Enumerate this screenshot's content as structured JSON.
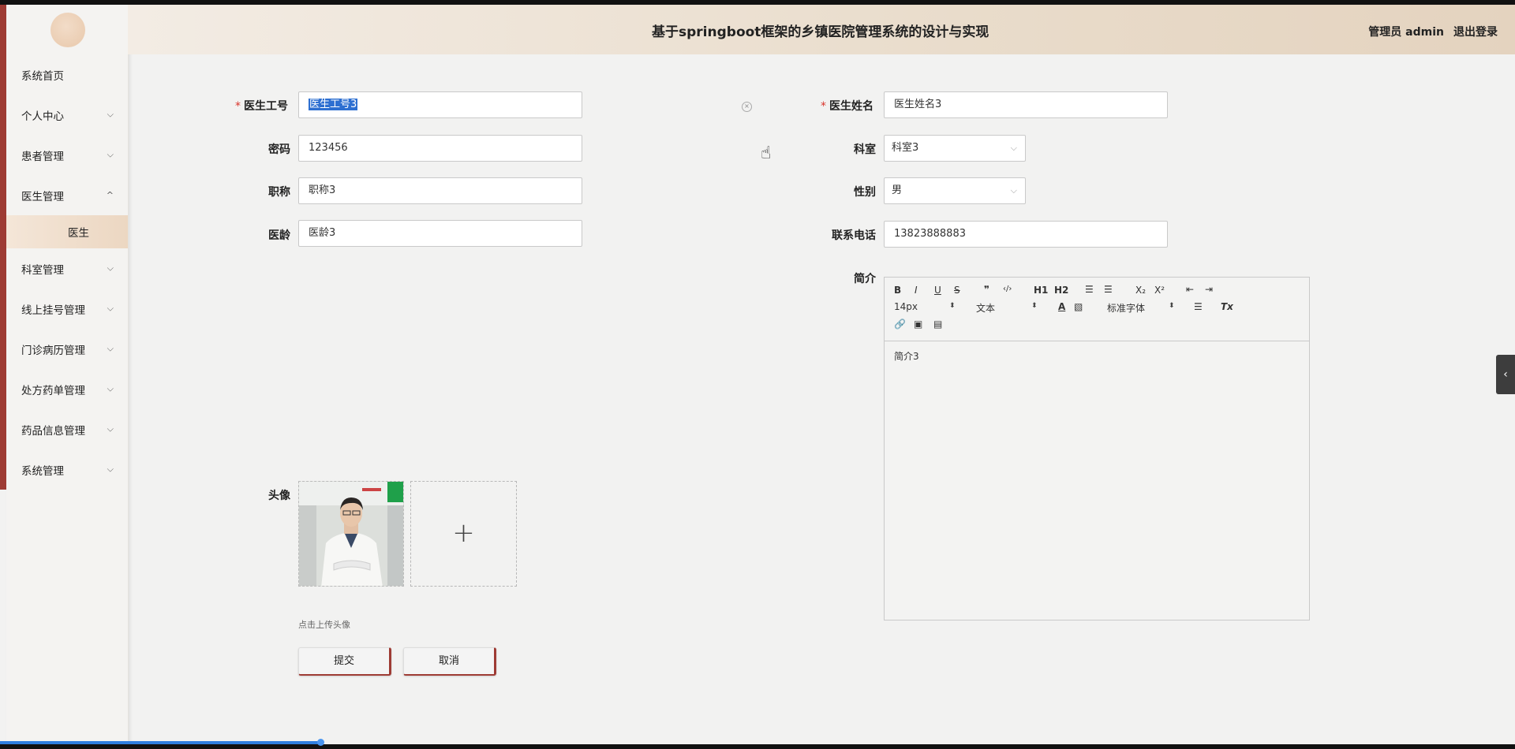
{
  "header": {
    "title": "基于springboot框架的乡镇医院管理系统的设计与实现",
    "user_label": "管理员 admin",
    "logout_label": "退出登录"
  },
  "sidebar": {
    "items": [
      {
        "label": "系统首页"
      },
      {
        "label": "个人中心"
      },
      {
        "label": "患者管理"
      },
      {
        "label": "医生管理"
      },
      {
        "label": "医生"
      },
      {
        "label": "科室管理"
      },
      {
        "label": "线上挂号管理"
      },
      {
        "label": "门诊病历管理"
      },
      {
        "label": "处方药单管理"
      },
      {
        "label": "药品信息管理"
      },
      {
        "label": "系统管理"
      }
    ]
  },
  "form": {
    "doctor_id": {
      "label": "医生工号",
      "value": "医生工号3"
    },
    "doctor_name": {
      "label": "医生姓名",
      "value": "医生姓名3"
    },
    "password": {
      "label": "密码",
      "value": "123456"
    },
    "department": {
      "label": "科室",
      "value": "科室3"
    },
    "title": {
      "label": "职称",
      "value": "职称3"
    },
    "gender": {
      "label": "性别",
      "value": "男"
    },
    "years": {
      "label": "医龄",
      "value": "医龄3"
    },
    "phone": {
      "label": "联系电话",
      "value": "13823888883"
    },
    "intro": {
      "label": "简介",
      "value": "简介3"
    },
    "avatar": {
      "label": "头像",
      "hint": "点击上传头像"
    },
    "submit_label": "提交",
    "cancel_label": "取消"
  },
  "editor": {
    "font_size": "14px",
    "block_type": "文本",
    "font_family": "标准字体",
    "buttons": [
      "B",
      "I",
      "U",
      "S",
      "❞",
      "‹/›",
      "H1",
      "H2",
      "ordered-list",
      "bullet-list",
      "X₂",
      "X²",
      "indent-left",
      "indent-right",
      "A",
      "highlight",
      "align",
      "Tx",
      "link",
      "image",
      "video"
    ]
  }
}
